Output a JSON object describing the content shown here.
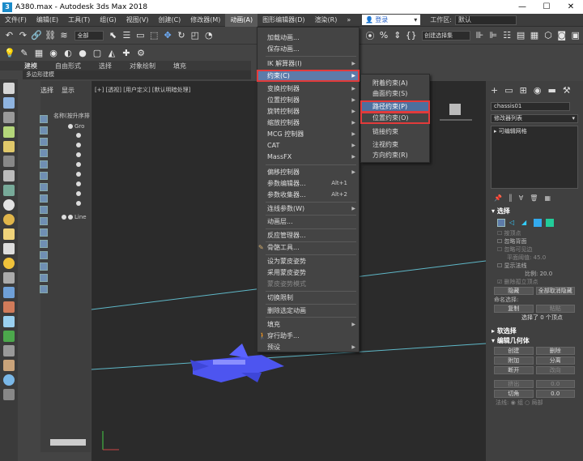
{
  "window": {
    "title": "A380.max - Autodesk 3ds Max 2018"
  },
  "menubar": {
    "items": [
      "文件(F)",
      "编辑(E)",
      "工具(T)",
      "组(G)",
      "视图(V)",
      "创建(C)",
      "修改器(M)",
      "动画(A)",
      "图形编辑器(D)",
      "渲染(R)"
    ],
    "login": "登录",
    "workspace_label": "工作区:",
    "workspace_value": "默认"
  },
  "toolbar": {
    "filter": "全部",
    "selection_set": "创建选择集"
  },
  "ribbon": {
    "tabs": [
      "建模",
      "自由形式",
      "选择",
      "对象绘制",
      "填充"
    ],
    "sub": "多边形建模"
  },
  "scene_explorer": {
    "tabs": [
      "选择",
      "显示"
    ],
    "header": "名称(按升序排",
    "root": "Gro",
    "last": "Line"
  },
  "viewport": {
    "label": "[+] [透视] [用户定义] [默认明暗处理]"
  },
  "anim_menu": {
    "items": [
      {
        "label": "加载动画...",
        "arrow": ""
      },
      {
        "label": "保存动画...",
        "arrow": ""
      },
      {
        "label": "IK 解算器(I)",
        "arrow": "▶"
      },
      {
        "label": "约束(C)",
        "arrow": "▶"
      },
      {
        "label": "变换控制器",
        "arrow": "▶"
      },
      {
        "label": "位置控制器",
        "arrow": "▶"
      },
      {
        "label": "旋转控制器",
        "arrow": "▶"
      },
      {
        "label": "缩放控制器",
        "arrow": "▶"
      },
      {
        "label": "MCG 控制器",
        "arrow": "▶"
      },
      {
        "label": "CAT",
        "arrow": "▶"
      },
      {
        "label": "MassFX",
        "arrow": "▶"
      },
      {
        "label": "偏移控制器",
        "arrow": "▶"
      },
      {
        "label": "参数编辑器...",
        "shortcut": "Alt+1"
      },
      {
        "label": "参数收集器...",
        "shortcut": "Alt+2"
      },
      {
        "label": "连线参数(W)",
        "arrow": "▶"
      },
      {
        "label": "动画层...",
        "arrow": ""
      },
      {
        "label": "反应管理器...",
        "arrow": ""
      },
      {
        "label": "骨骼工具...",
        "arrow": ""
      },
      {
        "label": "设为蒙皮姿势",
        "arrow": ""
      },
      {
        "label": "采用蒙皮姿势",
        "arrow": ""
      },
      {
        "label": "蒙皮姿势模式",
        "arrow": ""
      },
      {
        "label": "切换限制",
        "arrow": ""
      },
      {
        "label": "删除选定动画",
        "arrow": ""
      },
      {
        "label": "填充",
        "arrow": "▶"
      },
      {
        "label": "穿行助手...",
        "arrow": ""
      },
      {
        "label": "预设",
        "arrow": "▶"
      }
    ]
  },
  "constraint_menu": {
    "items": [
      "附着约束(A)",
      "曲面约束(S)",
      "路径约束(P)",
      "位置约束(O)",
      "链接约束",
      "注视约束",
      "方向约束(R)"
    ]
  },
  "command_panel": {
    "object_name": "chassis01",
    "modifier_list": "修改器列表",
    "stack_item": "可编辑网格",
    "selection": {
      "title": "选择",
      "by_vertex": "按顶点",
      "ignore_backface": "忽略背面",
      "ignore_visible": "忽略可见边",
      "planar_threshold": "平面阈值:",
      "planar_value": "45.0",
      "show_normals": "显示法线",
      "scale_label": "比例:",
      "scale_value": "20.0",
      "delete_isolated": "删除孤立顶点",
      "hide": "隐藏",
      "unhide_all": "全部取消隐藏",
      "named_sel": "命名选择:",
      "copy": "复制",
      "paste": "粘贴",
      "selected_count": "选择了 0 个顶点"
    },
    "soft_selection": "软选择",
    "edit_geometry": {
      "title": "编辑几何体",
      "create": "创建",
      "delete": "删除",
      "attach": "附加",
      "detach": "分离",
      "break": "断开",
      "turn": "改向",
      "extrude": "挤出",
      "chamfer": "切角",
      "extrude_val": "0.0",
      "chamfer_val": "0.0",
      "normal_label": "法线:",
      "group": "组",
      "local": "局部"
    }
  },
  "colors": {
    "accent": "#5d7ba9",
    "highlight_border": "#e23b3b",
    "airplane": "#4d55f0",
    "grid_line": "#5fb8c8"
  }
}
